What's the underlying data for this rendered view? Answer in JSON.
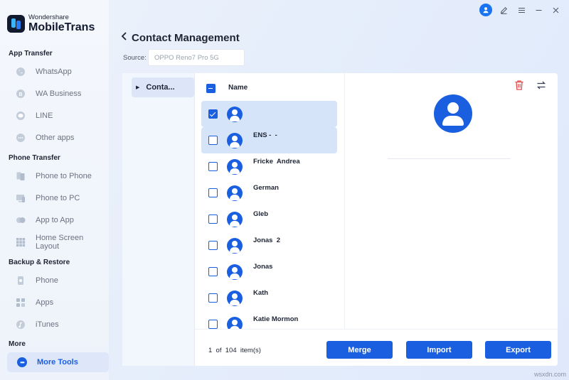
{
  "brand": {
    "sub": "Wondershare",
    "main": "MobileTrans"
  },
  "sidebar": {
    "sections": [
      {
        "title": "App Transfer",
        "items": [
          {
            "label": "WhatsApp",
            "icon": "whatsapp-icon"
          },
          {
            "label": "WA Business",
            "icon": "wa-business-icon"
          },
          {
            "label": "LINE",
            "icon": "line-icon"
          },
          {
            "label": "Other apps",
            "icon": "other-apps-icon"
          }
        ]
      },
      {
        "title": "Phone Transfer",
        "items": [
          {
            "label": "Phone to Phone",
            "icon": "phone-to-phone-icon"
          },
          {
            "label": "Phone to PC",
            "icon": "phone-to-pc-icon"
          },
          {
            "label": "App to App",
            "icon": "app-to-app-icon"
          },
          {
            "label": "Home Screen Layout",
            "icon": "grid-icon"
          }
        ]
      },
      {
        "title": "Backup & Restore",
        "items": [
          {
            "label": "Phone",
            "icon": "phone-icon"
          },
          {
            "label": "Apps",
            "icon": "apps-icon"
          },
          {
            "label": "iTunes",
            "icon": "itunes-icon"
          }
        ]
      },
      {
        "title": "More",
        "items": [
          {
            "label": "More Tools",
            "icon": "more-icon",
            "active": true
          }
        ]
      }
    ]
  },
  "header": {
    "title": "Contact Management",
    "source_label": "Source:",
    "source_value": "OPPO Reno7 Pro 5G"
  },
  "tree": {
    "item": "Conta..."
  },
  "list": {
    "header_name": "Name",
    "rows": [
      {
        "name": "",
        "checked": true,
        "selected": true
      },
      {
        "name": "ENS -  -",
        "checked": false,
        "selected": true
      },
      {
        "name": "Fricke  Andrea",
        "checked": false,
        "selected": false
      },
      {
        "name": "German",
        "checked": false,
        "selected": false
      },
      {
        "name": "Gleb",
        "checked": false,
        "selected": false
      },
      {
        "name": "Jonas  2",
        "checked": false,
        "selected": false
      },
      {
        "name": "Jonas",
        "checked": false,
        "selected": false
      },
      {
        "name": "Kath",
        "checked": false,
        "selected": false
      },
      {
        "name": "Katie Mormon",
        "checked": false,
        "selected": false
      }
    ]
  },
  "footer": {
    "count_text": "1  of  104  item(s)",
    "merge": "Merge",
    "import": "Import",
    "export": "Export"
  },
  "colors": {
    "accent": "#1a5fe0",
    "danger": "#e24a4a"
  },
  "watermark": "wsxdn.com"
}
